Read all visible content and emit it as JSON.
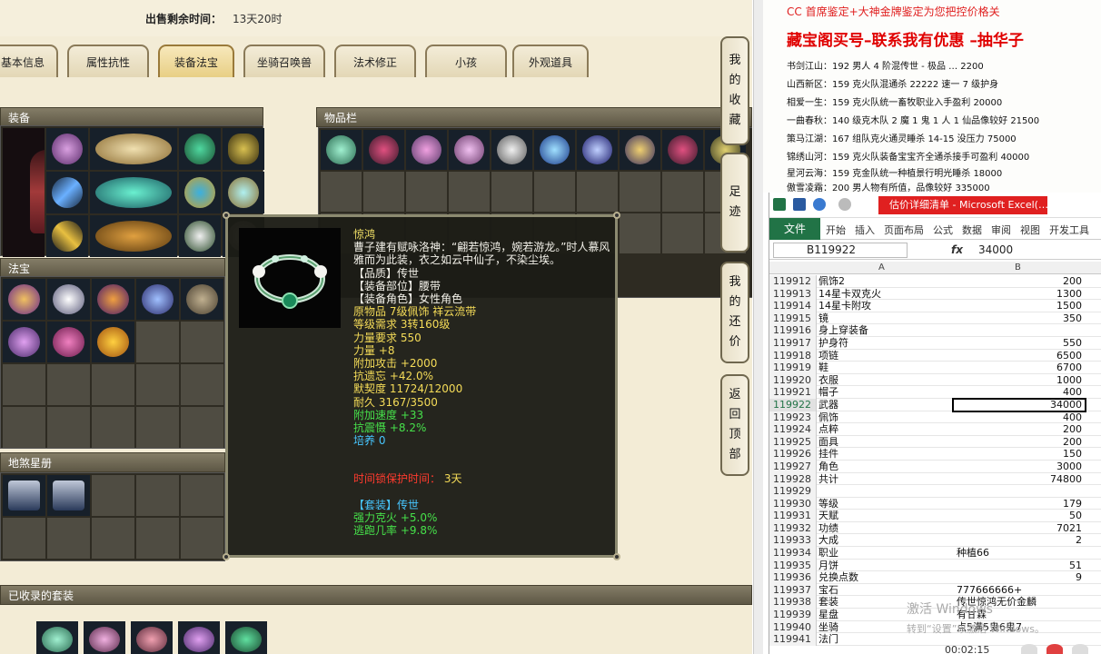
{
  "game": {
    "sale_label": "出售剩余时间：",
    "sale_value": "13天20时",
    "tabs": [
      "基本信息",
      "属性抗性",
      "装备法宝",
      "坐骑召唤兽",
      "法术修正",
      "小孩",
      "外观道具"
    ],
    "active_tab": "装备法宝",
    "panels": {
      "equipment": "装备",
      "inventory": "物品栏",
      "treasure": "法宝",
      "dizhao": "地煞星册",
      "collected_sets": "已收录的套装"
    },
    "side_buttons": [
      [
        "我",
        "的",
        "收",
        "藏"
      ],
      [
        "足",
        "迹"
      ],
      [
        "我",
        "的",
        "还",
        "价"
      ],
      [
        "返",
        "回",
        "顶",
        "部"
      ]
    ]
  },
  "tooltip": {
    "name": "惊鸿",
    "desc": "曹子建有赋咏洛神：“翩若惊鸿，婉若游龙。”时人慕风雅而为此装，衣之如云中仙子，不染尘埃。",
    "quality": "【品质】传世",
    "slot": "【装备部位】腰带",
    "role": "【装备角色】女性角色",
    "origin": "原物品 7级佩饰 祥云流带",
    "level_req": "等级需求 3转160级",
    "str_req": "力量要求 550",
    "str": "力量 +8",
    "atk": "附加攻击 +2000",
    "resist": "抗遗忘 +42.0%",
    "bond": "默契度 11724/12000",
    "durability": "耐久 3167/3500",
    "speed": "附加速度 +33",
    "shock": "抗震慑 +8.2%",
    "nurture": "培养 0",
    "protect_label": "时间锁保护时间：",
    "protect_value": "3天",
    "set_label": "【套装】传世",
    "set_1": "强力克火 +5.0%",
    "set_2": "逃跑几率 +9.8%"
  },
  "promo": {
    "line1": "CC 首席鉴定+大神金牌鉴定为您把控价格关",
    "headline": "藏宝阁买号–联系我有优惠 –抽华子",
    "items": [
      "书剑江山：192 男人 4 阶混传世 - 极品 … 2200",
      "山西新区：159 克火队混通杀 22222 速一 7 级护身",
      "相爱一生：159 克火队统一畜牧职业入手盈利 20000",
      "一曲春秋：140 级克木队 2 魔 1 鬼 1 人 1 仙品像较好 21500",
      "策马江湖：167 组队克火通灵睡杀 14-15 没压力 75000",
      "锦绣山河：159 克火队装备宝宝齐全通杀接手可盈利 40000",
      "星河云海：159 克金队统一种植景行明光睡杀 18000",
      "傲雪凌霜：200 男人物有所值，品像较好 335000"
    ]
  },
  "excel": {
    "title": "估价详细清单 - Microsoft Excel(…",
    "ribbon_tabs": [
      "文件",
      "开始",
      "插入",
      "页面布局",
      "公式",
      "数据",
      "审阅",
      "视图",
      "开发工具"
    ],
    "name_box": "B119922",
    "formula_value": "34000",
    "col_a": "A",
    "col_b": "B",
    "rows": [
      {
        "n": "119912",
        "a": "佩饰2",
        "b": "200"
      },
      {
        "n": "119913",
        "a": "14星卡双克火",
        "b": "1300"
      },
      {
        "n": "119914",
        "a": "14星卡附攻",
        "b": "1500"
      },
      {
        "n": "119915",
        "a": "镜",
        "b": "350"
      },
      {
        "n": "119916",
        "a": "身上穿装备",
        "b": ""
      },
      {
        "n": "119917",
        "a": "护身符",
        "b": "550"
      },
      {
        "n": "119918",
        "a": "项链",
        "b": "6500"
      },
      {
        "n": "119919",
        "a": "鞋",
        "b": "6700"
      },
      {
        "n": "119920",
        "a": "衣服",
        "b": "1000"
      },
      {
        "n": "119921",
        "a": "帽子",
        "b": "400"
      },
      {
        "n": "119922",
        "a": "武器",
        "b": "34000"
      },
      {
        "n": "119923",
        "a": "佩饰",
        "b": "400"
      },
      {
        "n": "119924",
        "a": "点粹",
        "b": "200"
      },
      {
        "n": "119925",
        "a": "面具",
        "b": "200"
      },
      {
        "n": "119926",
        "a": "挂件",
        "b": "150"
      },
      {
        "n": "119927",
        "a": "角色",
        "b": "3000"
      },
      {
        "n": "119928",
        "a": "共计",
        "b": "74800"
      },
      {
        "n": "119929",
        "a": "",
        "b": ""
      },
      {
        "n": "119930",
        "a": "等级",
        "b": "179"
      },
      {
        "n": "119931",
        "a": "天赋",
        "b": "50"
      },
      {
        "n": "119932",
        "a": "功绩",
        "b": "7021"
      },
      {
        "n": "119933",
        "a": "大成",
        "b": "2"
      },
      {
        "n": "119934",
        "a": "职业",
        "b": "种植66",
        "left": true
      },
      {
        "n": "119935",
        "a": "月饼",
        "b": "51"
      },
      {
        "n": "119936",
        "a": "兑换点数",
        "b": "9"
      },
      {
        "n": "119937",
        "a": "宝石",
        "b": "777666666+",
        "left": true
      },
      {
        "n": "119938",
        "a": "套装",
        "b": "传世惊鸿无价金麟",
        "left": true
      },
      {
        "n": "119939",
        "a": "星盘",
        "b": "有甘霖",
        "left": true
      },
      {
        "n": "119940",
        "a": "坐骑",
        "b": "点5满5鬼6鬼7",
        "left": true
      },
      {
        "n": "119941",
        "a": "法门",
        "b": ""
      }
    ],
    "selected_row": "119922"
  },
  "overlay": {
    "watermark": "激活 Windows",
    "watermark2": "转到“设置”以激活 Windows。",
    "timer": "00:02:15"
  },
  "colors": {
    "excel_green": "#217346",
    "promo_red": "#e00000",
    "tooltip_yellow": "#f2e066",
    "tooltip_green": "#46e04a",
    "tooltip_cyan": "#47c6ff"
  }
}
